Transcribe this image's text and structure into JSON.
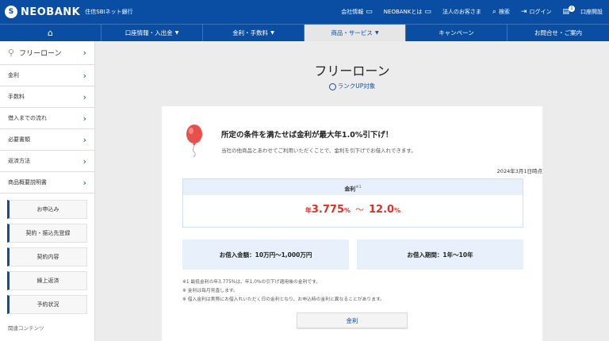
{
  "header": {
    "logo_mark": "S",
    "logo_text": "NEOBANK",
    "logo_sub": "住信SBIネット銀行",
    "utility": [
      {
        "label": "会社情報",
        "icon": "▭"
      },
      {
        "label": "NEOBANKとは",
        "icon": "▭"
      },
      {
        "label": "法人のお客さま",
        "icon": ""
      },
      {
        "label": "検索",
        "icon": "⌕"
      },
      {
        "label": "ログイン",
        "icon": "⇥"
      },
      {
        "label": "口座開設",
        "icon": "▤"
      }
    ],
    "badge": "1"
  },
  "nav": [
    {
      "label": "⌂"
    },
    {
      "label": "口座情報・入出金"
    },
    {
      "label": "金利・手数料"
    },
    {
      "label": "商品・サービス"
    },
    {
      "label": "キャンペーン"
    },
    {
      "label": "お問合せ・ご案内"
    }
  ],
  "sidebar": {
    "top": "フリーローン",
    "items": [
      "金利",
      "手数料",
      "借入までの流れ",
      "必要書類",
      "返済方法",
      "商品概要説明書"
    ],
    "buttons": [
      "お申込み",
      "契約・振込先登録",
      "契約内容",
      "繰上返済",
      "予約状況"
    ],
    "related": "関連コンテンツ"
  },
  "main": {
    "title": "フリーローン",
    "rankup": "ランクUP対象",
    "promo_title": "所定の条件を満たせば金利が最大年1.0%引下げ！",
    "promo_desc": "当社の他商品とあわせてご利用いただくことで、金利を引下げでお借入れできます。",
    "as_of": "2024年3月1日時点",
    "rate_label": "金利",
    "rate_note_mark": "※1",
    "rate_prefix": "年",
    "rate_min": "3.775",
    "rate_pct": "%",
    "rate_tilde": "～",
    "rate_max": "12.0",
    "loan_amount": "お借入金額：10万円～1,000万円",
    "loan_period": "お借入期間：1年～10年",
    "notes": [
      "※1 最低金利の年3.775%は、年1.0%の引下げ適用後の金利です。",
      "※ 金利は毎月見直します。",
      "※ 借入金利は実際にお借入れいただく日の金利となり、お申込時の金利と異なることがあります。"
    ],
    "kinri_button": "金利"
  }
}
